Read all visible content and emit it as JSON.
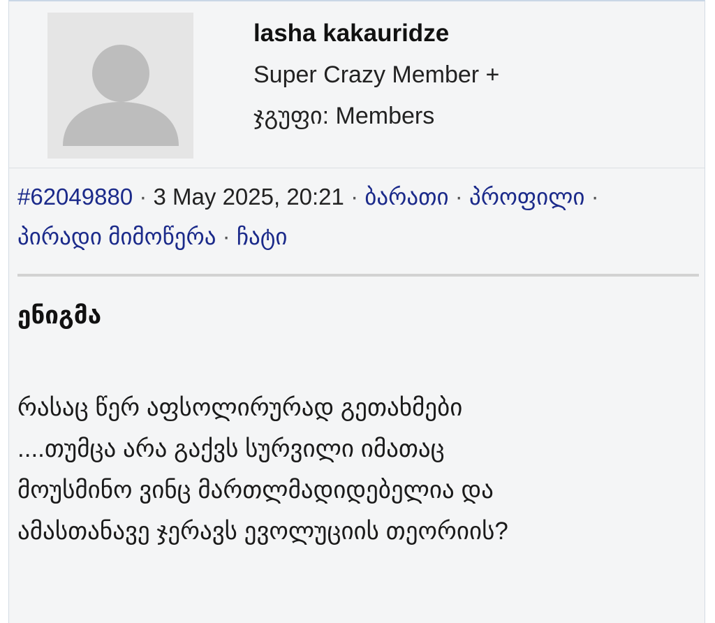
{
  "author": {
    "name": "lasha kakauridze",
    "rank": "Super Crazy Member +",
    "group_label": "ჯგუფი:",
    "group_value": "Members"
  },
  "post_meta": {
    "post_id": "#62049880",
    "date": "3 May 2025, 20:21",
    "links": {
      "card": "ბარათი",
      "profile": "პროფილი",
      "private_message": "პირადი მიმოწერა",
      "chat": "ჩატი"
    },
    "separator": "·"
  },
  "post": {
    "title": "ენიგმა",
    "body_lines": [
      "რასაც წერ აფსოლირურად გეთახმები",
      "....თუმცა არა გაქვს სურვილი იმათაც",
      "მოუსმინო ვინც მართლმადიდებელია და",
      "ამასთანავე ჯერავს ევოლუციის თეორიის?"
    ]
  },
  "colors": {
    "link": "#1b2a8a",
    "background": "#f4f5f6",
    "avatar_bg": "#e5e5e5",
    "avatar_fg": "#bdbdbd"
  },
  "icons": {
    "avatar": "default-user-avatar-icon"
  }
}
